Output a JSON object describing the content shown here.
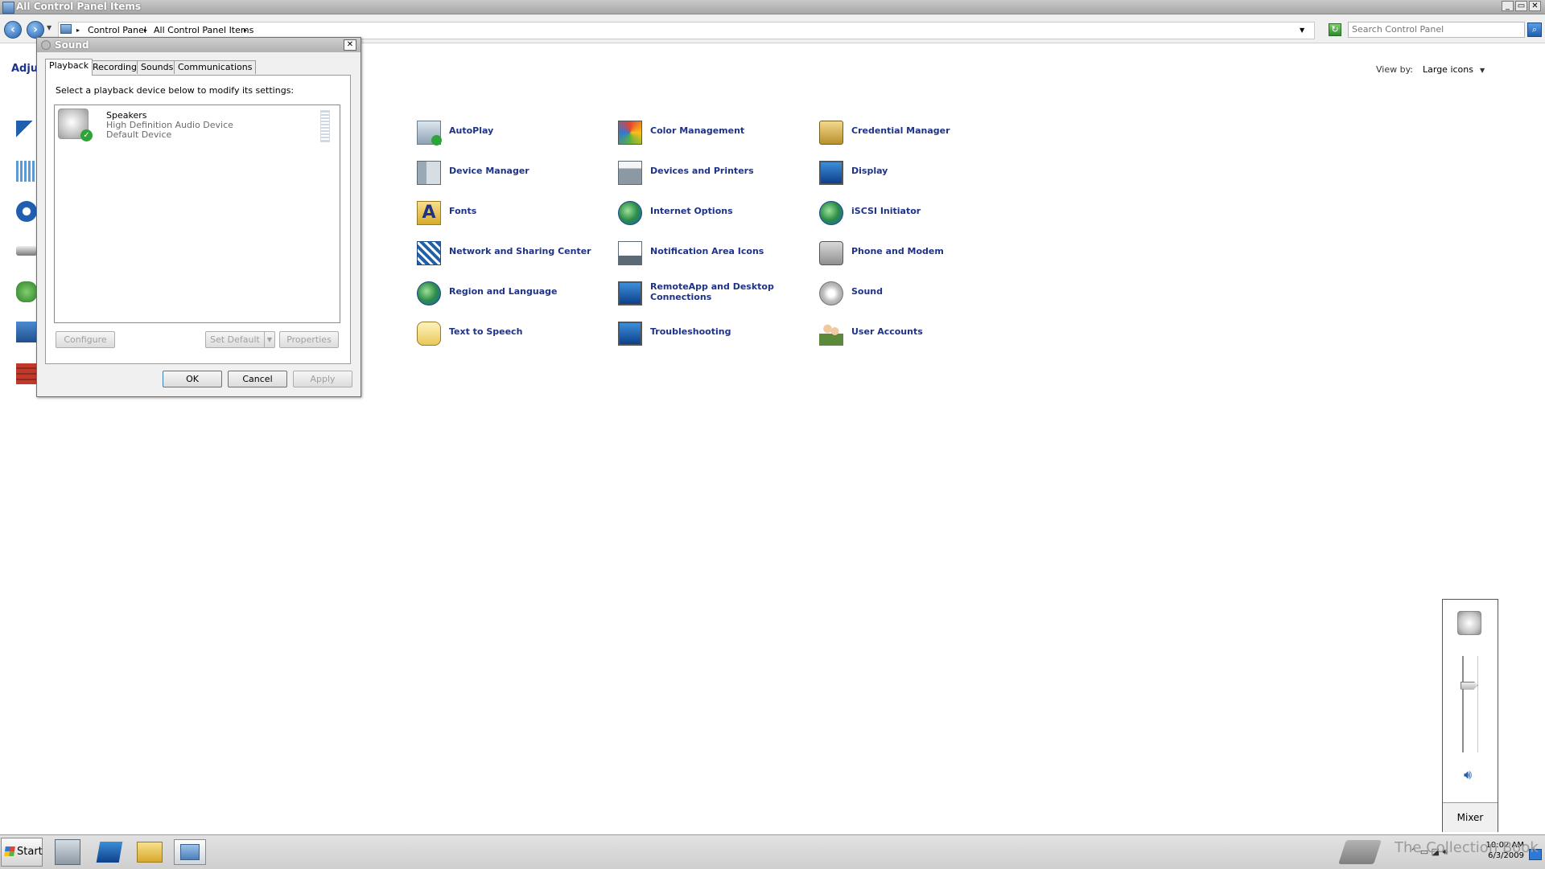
{
  "window": {
    "title": "All Control Panel Items",
    "min_label": "_",
    "max_label": "▭",
    "close_label": "✕"
  },
  "address": {
    "crumb1": "Control Panel",
    "crumb2": "All Control Panel Items",
    "search_placeholder": "Search Control Panel"
  },
  "content": {
    "adjust_text": "Adju",
    "viewby_label": "View by:",
    "viewby_value": "Large icons",
    "items": [
      {
        "label": "AutoPlay"
      },
      {
        "label": "Color Management"
      },
      {
        "label": "Credential Manager"
      },
      {
        "label": "Device Manager"
      },
      {
        "label": "Devices and Printers"
      },
      {
        "label": "Display"
      },
      {
        "label": "Fonts"
      },
      {
        "label": "Internet Options"
      },
      {
        "label": "iSCSI Initiator"
      },
      {
        "label": "Network and Sharing Center"
      },
      {
        "label": "Notification Area Icons"
      },
      {
        "label": "Phone and Modem"
      },
      {
        "label": "Region and Language"
      },
      {
        "label": "RemoteApp and Desktop Connections"
      },
      {
        "label": "Sound"
      },
      {
        "label": "Text to Speech"
      },
      {
        "label": "Troubleshooting"
      },
      {
        "label": "User Accounts"
      }
    ]
  },
  "dialog": {
    "title": "Sound",
    "close_label": "✕",
    "tabs": [
      "Playback",
      "Recording",
      "Sounds",
      "Communications"
    ],
    "instruction": "Select a playback device below to modify its settings:",
    "device": {
      "name": "Speakers",
      "description": "High Definition Audio Device",
      "status": "Default Device"
    },
    "buttons": {
      "configure": "Configure",
      "set_default": "Set Default",
      "properties": "Properties",
      "ok": "OK",
      "cancel": "Cancel",
      "apply": "Apply"
    }
  },
  "mixer": {
    "label": "Mixer",
    "volume_fraction": 0.35
  },
  "taskbar": {
    "start_label": "Start",
    "watermark": "The Collection Book",
    "time": "10:02 AM",
    "date": "6/3/2009"
  },
  "colors": {
    "link": "#1e3287",
    "accent": "#1f5fae"
  }
}
